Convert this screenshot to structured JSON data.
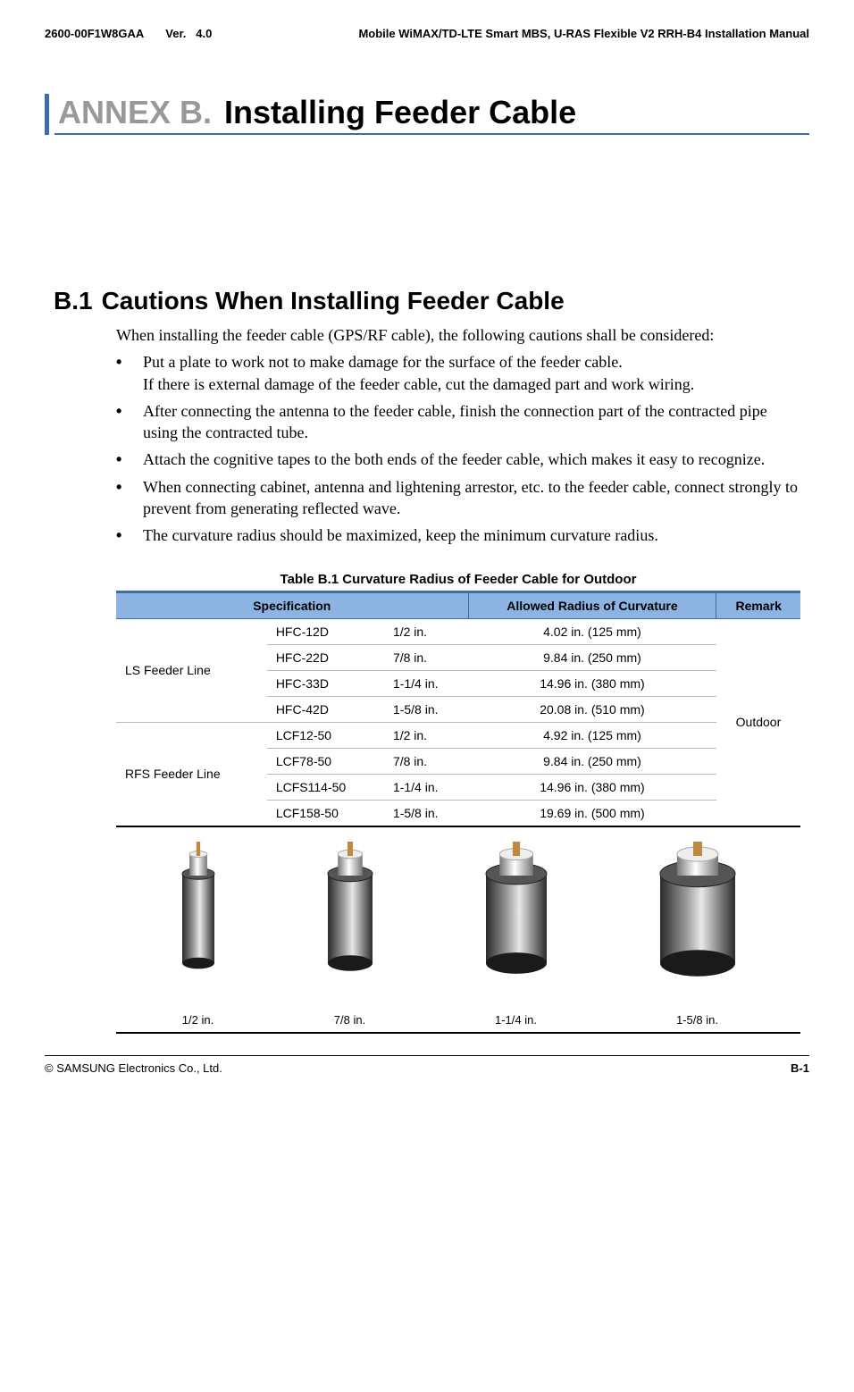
{
  "header": {
    "doc_id": "2600-00F1W8GAA",
    "ver_label": "Ver.",
    "ver_value": "4.0",
    "product": "Mobile WiMAX/TD-LTE Smart MBS, U-RAS Flexible V2 RRH-B4 Installation Manual"
  },
  "annex": {
    "prefix": "ANNEX B.",
    "title": "Installing Feeder Cable"
  },
  "section": {
    "number": "B.1",
    "title": "Cautions When Installing Feeder Cable",
    "intro": "When installing the feeder cable (GPS/RF cable), the following cautions shall be considered:",
    "bullets": [
      "Put a plate to work not to make damage for the surface of the feeder cable.\nIf there is external damage of the feeder cable, cut the damaged part and work wiring.",
      "After connecting the antenna to the feeder cable, finish the connection part of the contracted pipe using the contracted tube.",
      "Attach the cognitive tapes to the both ends of the feeder cable, which makes it easy to recognize.",
      "When connecting cabinet, antenna and lightening arrestor, etc. to the feeder cable, connect strongly to prevent from generating reflected wave.",
      "The curvature radius should be maximized, keep the minimum curvature radius."
    ]
  },
  "table": {
    "caption": "Table B.1    Curvature Radius of Feeder Cable for Outdoor",
    "headers": {
      "spec": "Specification",
      "radius": "Allowed Radius of Curvature",
      "remark": "Remark"
    },
    "remark_value": "Outdoor",
    "groups": [
      {
        "name": "LS Feeder Line",
        "rows": [
          {
            "model": "HFC-12D",
            "size": "1/2 in.",
            "radius": "4.02 in. (125 mm)"
          },
          {
            "model": "HFC-22D",
            "size": "7/8 in.",
            "radius": "9.84 in. (250 mm)"
          },
          {
            "model": "HFC-33D",
            "size": "1-1/4 in.",
            "radius": "14.96 in. (380 mm)"
          },
          {
            "model": "HFC-42D",
            "size": "1-5/8 in.",
            "radius": "20.08 in. (510 mm)"
          }
        ]
      },
      {
        "name": "RFS Feeder Line",
        "rows": [
          {
            "model": "LCF12-50",
            "size": "1/2 in.",
            "radius": "4.92 in. (125 mm)"
          },
          {
            "model": "LCF78-50",
            "size": "7/8 in.",
            "radius": "9.84 in. (250 mm)"
          },
          {
            "model": "LCFS114-50",
            "size": "1-1/4 in.",
            "radius": "14.96 in. (380 mm)"
          },
          {
            "model": "LCF158-50",
            "size": "1-5/8 in.",
            "radius": "19.69 in. (500 mm)"
          }
        ]
      }
    ],
    "images": [
      {
        "label": "1/2 in."
      },
      {
        "label": "7/8 in."
      },
      {
        "label": "1-1/4 in."
      },
      {
        "label": "1-5/8 in."
      }
    ]
  },
  "footer": {
    "copyright": "© SAMSUNG Electronics Co., Ltd.",
    "page": "B-1"
  }
}
